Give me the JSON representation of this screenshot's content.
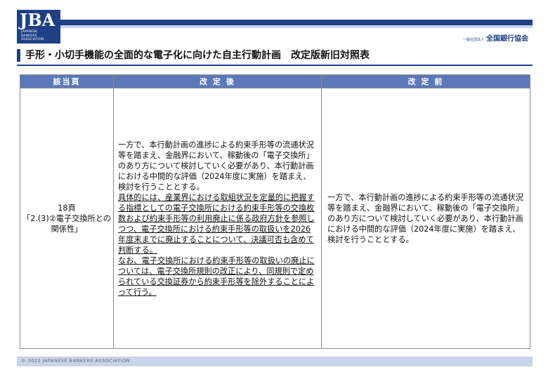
{
  "logo": {
    "mark": "JBA",
    "sub_lines": [
      "JAPANESE",
      "BANKERS",
      "ASSOCIATION"
    ]
  },
  "org": {
    "prefix": "一般社団法人",
    "name": "全国銀行協会"
  },
  "title": "手形・小切手機能の全面的な電子化に向けた自主行動計画　改定版新旧対照表",
  "table": {
    "headers": {
      "page": "該当頁",
      "after": "改 定 後",
      "before": "改 定 前"
    },
    "page_ref": {
      "line1": "18頁",
      "line2": "「2.(3)②電子交換所との関係性」"
    },
    "after": {
      "p1": "一方で、本行動計画の進捗による約束手形等の流通状況等を踏まえ、金融界において、稼動後の「電子交換所」のあり方について検討していく必要があり、本行動計画における中間的な評価（2024年度に実施）を踏まえ、検討を行うこととする。",
      "p2": "具体的には、産業界における取組状況を定量的に把握する指標としての電子交換所における約束手形等の交換枚数および約束手形等の利用廃止に係る政府方針を参照しつつ、電子交換所における約束手形等の取扱いを2026年度末までに廃止することについて、決議可否も含めて判断する。",
      "p3": "なお、電子交換所における約束手形等の取扱いの廃止については、電子交換所規則の改正により、同規則で定められている交換証券から約束手形等を除外することによって行う。"
    },
    "before": {
      "p1": "一方で、本行動計画の進捗による約束手形等の流通状況等を踏まえ、金融界において、稼動後の「電子交換所」のあり方について検討していく必要があり、本行動計画における中間的な評価（2024年度に実施）を踏まえ、検討を行うこととする。"
    }
  },
  "footer": {
    "copyright": "© 2022 JAPANESE BANKERS ASSOCIATION"
  },
  "colors": {
    "brand": "#1f3f86",
    "header_cell": "#5b79b8",
    "light_band": "#c9d3ea"
  }
}
